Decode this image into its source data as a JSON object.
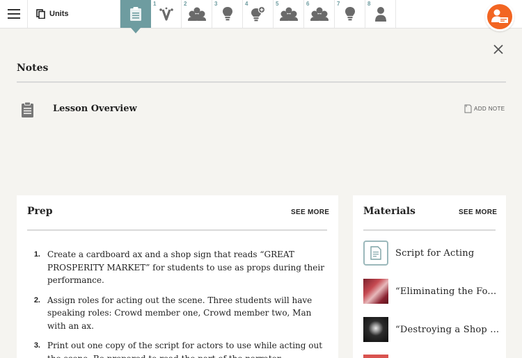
{
  "header": {
    "units_label": "Units",
    "tabs": [
      {
        "num": "",
        "icon": "clipboard-icon",
        "active": true
      },
      {
        "num": "1",
        "icon": "vocabulary-icon"
      },
      {
        "num": "2",
        "icon": "group-icon"
      },
      {
        "num": "3",
        "icon": "lightbulb-icon"
      },
      {
        "num": "4",
        "icon": "lightbulb-plus-icon"
      },
      {
        "num": "5",
        "icon": "group-icon"
      },
      {
        "num": "6",
        "icon": "group-icon"
      },
      {
        "num": "7",
        "icon": "lightbulb-icon"
      },
      {
        "num": "8",
        "icon": "person-icon"
      }
    ]
  },
  "notes": {
    "title": "Notes",
    "lesson_title": "Lesson Overview",
    "add_note_label": "ADD NOTE"
  },
  "prep": {
    "title": "Prep",
    "see_more": "SEE MORE",
    "items": [
      {
        "num": "1.",
        "text": "Create a cardboard ax and a shop sign that reads “GREAT PROSPERITY MARKET” for students to use as props during their performance."
      },
      {
        "num": "2.",
        "text": "Assign roles for acting out the scene. Three students will have speaking roles: Crowd member one, Crowd member two, Man with an ax."
      },
      {
        "num": "3.",
        "text": "Print out one copy of the script for actors to use while acting out the scene. Be prepared to read the part of the narrator."
      }
    ]
  },
  "materials": {
    "title": "Materials",
    "see_more": "SEE MORE",
    "items": [
      {
        "label": "Script for Acting",
        "thumb": "document-icon"
      },
      {
        "label": "“Eliminating the Fo...",
        "thumb": "photo-red"
      },
      {
        "label": "“Destroying a Shop ...",
        "thumb": "photo-dark"
      }
    ]
  },
  "colors": {
    "accent_teal": "#6e9ca0",
    "avatar_orange": "#f26522"
  }
}
